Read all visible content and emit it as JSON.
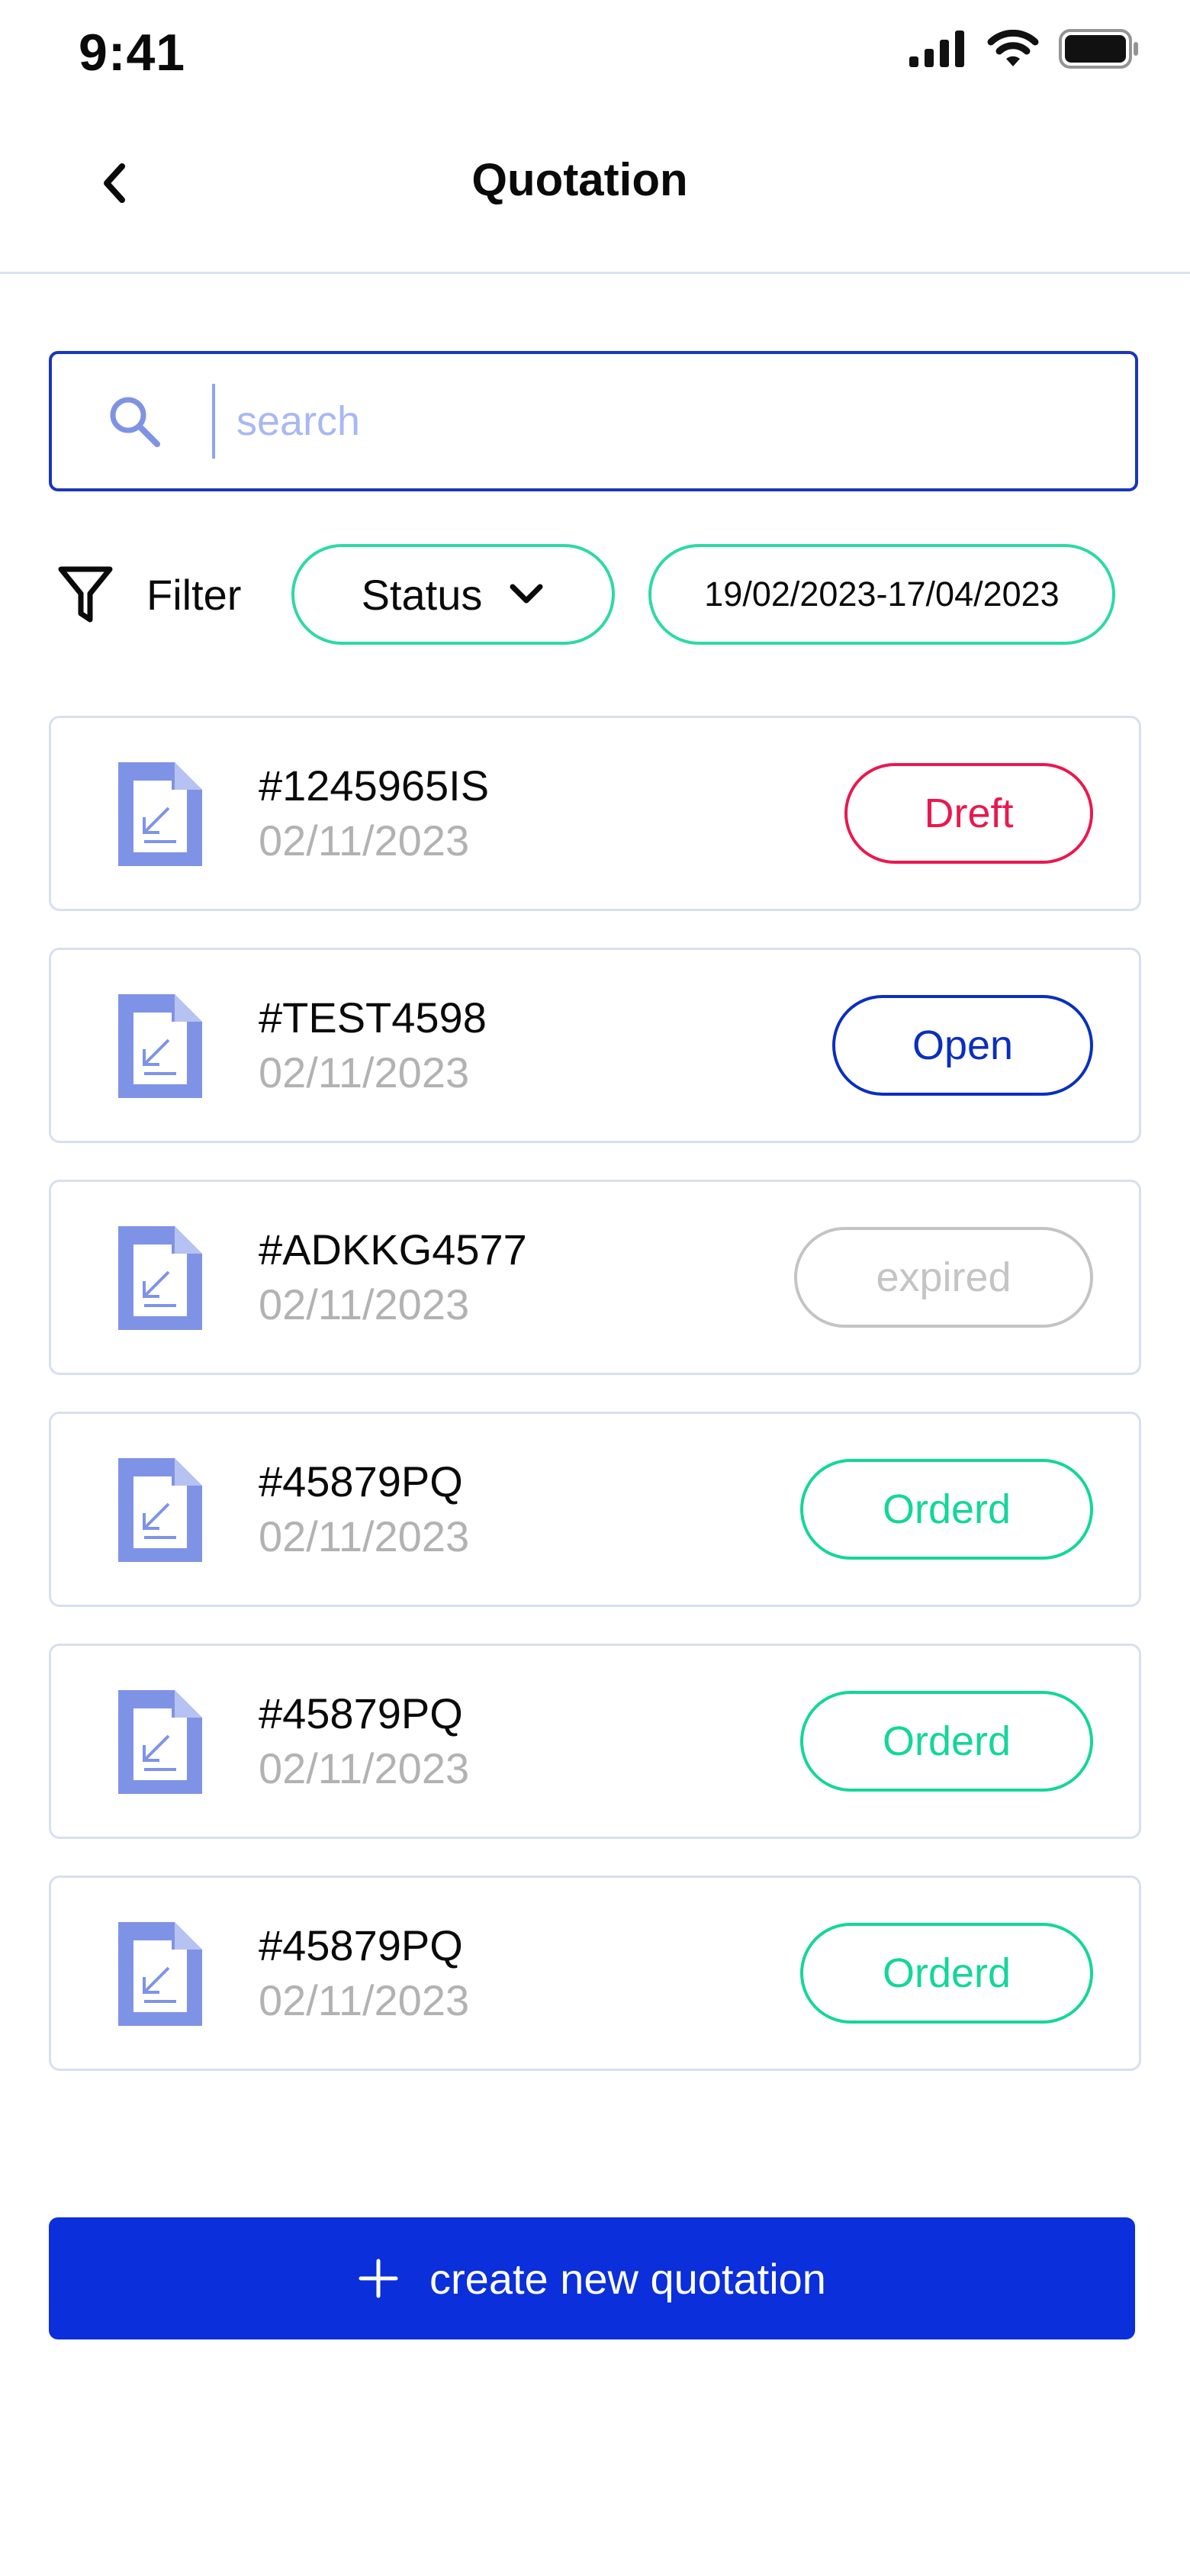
{
  "status_bar": {
    "time": "9:41"
  },
  "header": {
    "title": "Quotation"
  },
  "search": {
    "placeholder": "search",
    "value": ""
  },
  "filter": {
    "label": "Filter",
    "status_label": "Status",
    "date_range": "19/02/2023-17/04/2023"
  },
  "quotations": [
    {
      "code": "#1245965IS",
      "date": "02/11/2023",
      "status": "Dreft"
    },
    {
      "code": "#TEST4598",
      "date": "02/11/2023",
      "status": "Open"
    },
    {
      "code": "#ADKKG4577",
      "date": "02/11/2023",
      "status": "expired"
    },
    {
      "code": "#45879PQ",
      "date": "02/11/2023",
      "status": "Orderd"
    },
    {
      "code": "#45879PQ",
      "date": "02/11/2023",
      "status": "Orderd"
    },
    {
      "code": "#45879PQ",
      "date": "02/11/2023",
      "status": "Orderd"
    }
  ],
  "status_colors": {
    "Dreft": "#e8194f",
    "Open": "#0a2fbf",
    "expired": "#c4c4c4",
    "Orderd": "#14d69a"
  },
  "cta": {
    "label": "create new quotation"
  },
  "colors": {
    "primary": "#0a2fdb",
    "accent": "#2dd9a6",
    "icon": "#7f93e6"
  },
  "icons": {
    "back": "chevron-left-icon",
    "search": "search-icon",
    "filter": "funnel-icon",
    "dropdown": "chevron-down-icon",
    "document": "document-icon",
    "add": "plus-icon"
  }
}
